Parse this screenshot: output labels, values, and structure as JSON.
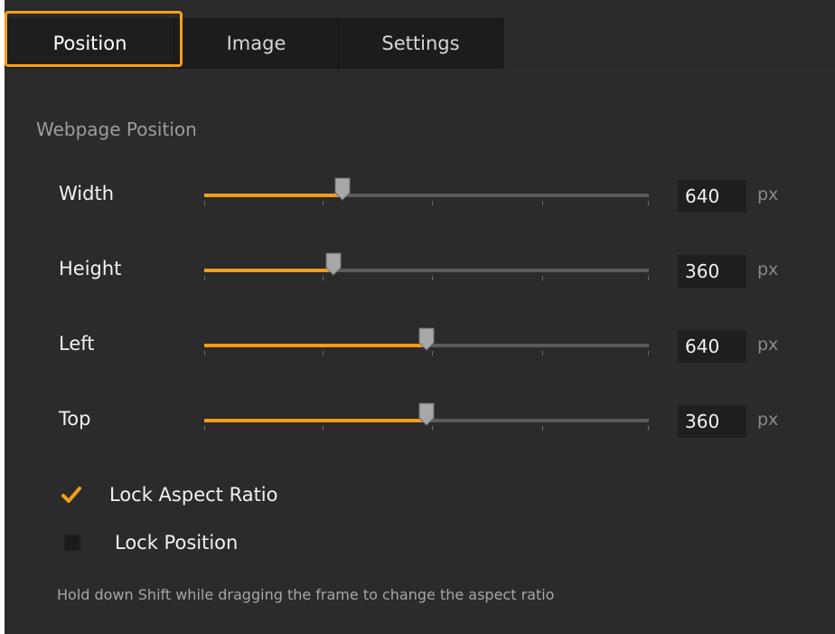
{
  "tabs": [
    {
      "label": "Position",
      "active": true
    },
    {
      "label": "Image",
      "active": false
    },
    {
      "label": "Settings",
      "active": false
    }
  ],
  "section_title": "Webpage Position",
  "rows": [
    {
      "label": "Width",
      "value": "640",
      "unit": "px",
      "slider_fraction": 0.31
    },
    {
      "label": "Height",
      "value": "360",
      "unit": "px",
      "slider_fraction": 0.29
    },
    {
      "label": "Left",
      "value": "640",
      "unit": "px",
      "slider_fraction": 0.5
    },
    {
      "label": "Top",
      "value": "360",
      "unit": "px",
      "slider_fraction": 0.5
    }
  ],
  "checkboxes": [
    {
      "label": "Lock Aspect Ratio",
      "checked": true
    },
    {
      "label": "Lock Position",
      "checked": false
    }
  ],
  "hint": "Hold down Shift while dragging the frame to change the aspect ratio",
  "colors": {
    "accent": "#f59d1b",
    "panel": "#2b2b2b",
    "tab_bg": "#1c1c1c",
    "input_bg": "#1f1f1f"
  }
}
